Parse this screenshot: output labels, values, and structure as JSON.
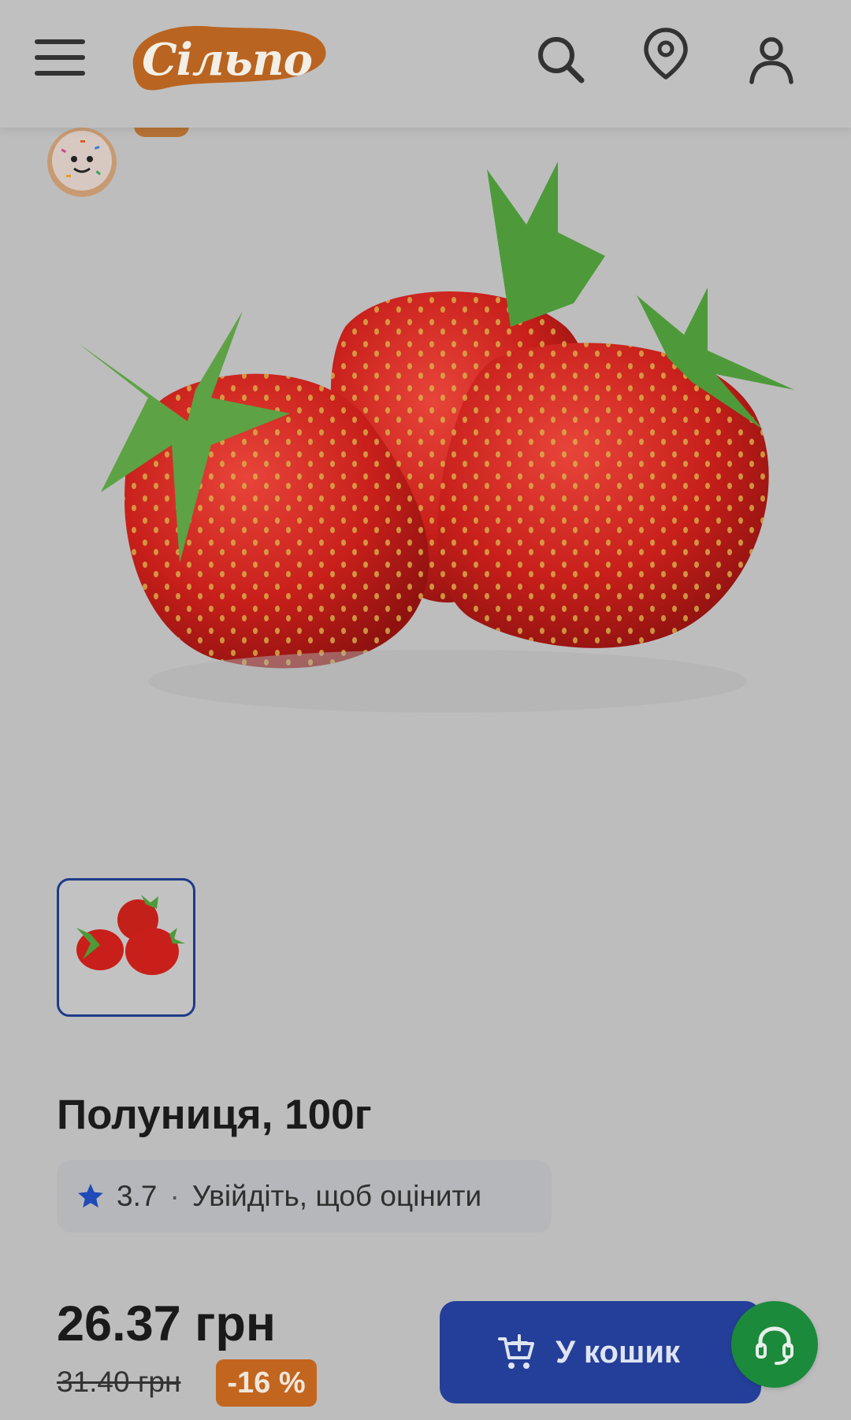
{
  "header": {
    "logo_text": "Сільпо",
    "icons": [
      "menu-icon",
      "search-icon",
      "location-pin-icon",
      "user-icon"
    ]
  },
  "product": {
    "title": "Полуниця, 100г",
    "rating": {
      "value": "3.7",
      "separator": "·",
      "login_prompt": "Увійдіть, щоб оцінити"
    },
    "price": "26.37 грн",
    "old_price": "31.40 грн",
    "discount": "-16 %"
  },
  "actions": {
    "add_to_cart": "У кошик"
  },
  "colors": {
    "brand_orange": "#c2651e",
    "primary_blue": "#243f99",
    "support_green": "#1b8a3b",
    "star_blue": "#1e4bb8"
  }
}
